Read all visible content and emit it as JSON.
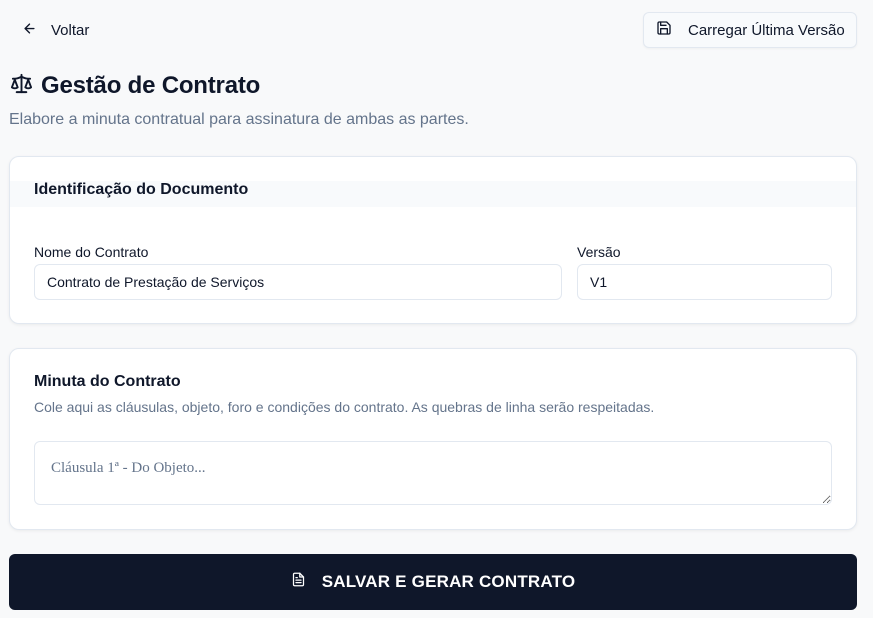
{
  "topbar": {
    "back_label": "Voltar",
    "load_label": "Carregar Última Versão"
  },
  "header": {
    "title": "Gestão de Contrato",
    "subtitle": "Elabore a minuta contratual para assinatura de ambas as partes."
  },
  "identification": {
    "title": "Identificação do Documento",
    "name_label": "Nome do Contrato",
    "name_value": "Contrato de Prestação de Serviços",
    "version_label": "Versão",
    "version_value": "V1"
  },
  "draft": {
    "title": "Minuta do Contrato",
    "description": "Cole aqui as cláusulas, objeto, foro e condições do contrato. As quebras de linha serão respeitadas.",
    "placeholder": "Cláusula 1ª - Do Objeto..."
  },
  "submit": {
    "label": "SALVAR E GERAR CONTRATO"
  },
  "icons": {
    "back": "arrow-left-icon",
    "load": "save-icon",
    "title": "scale-icon",
    "submit": "file-text-icon"
  },
  "colors": {
    "primary": "#0f172a",
    "muted": "#64748b",
    "border": "#e2e8f0",
    "background": "#f8f9fa"
  }
}
